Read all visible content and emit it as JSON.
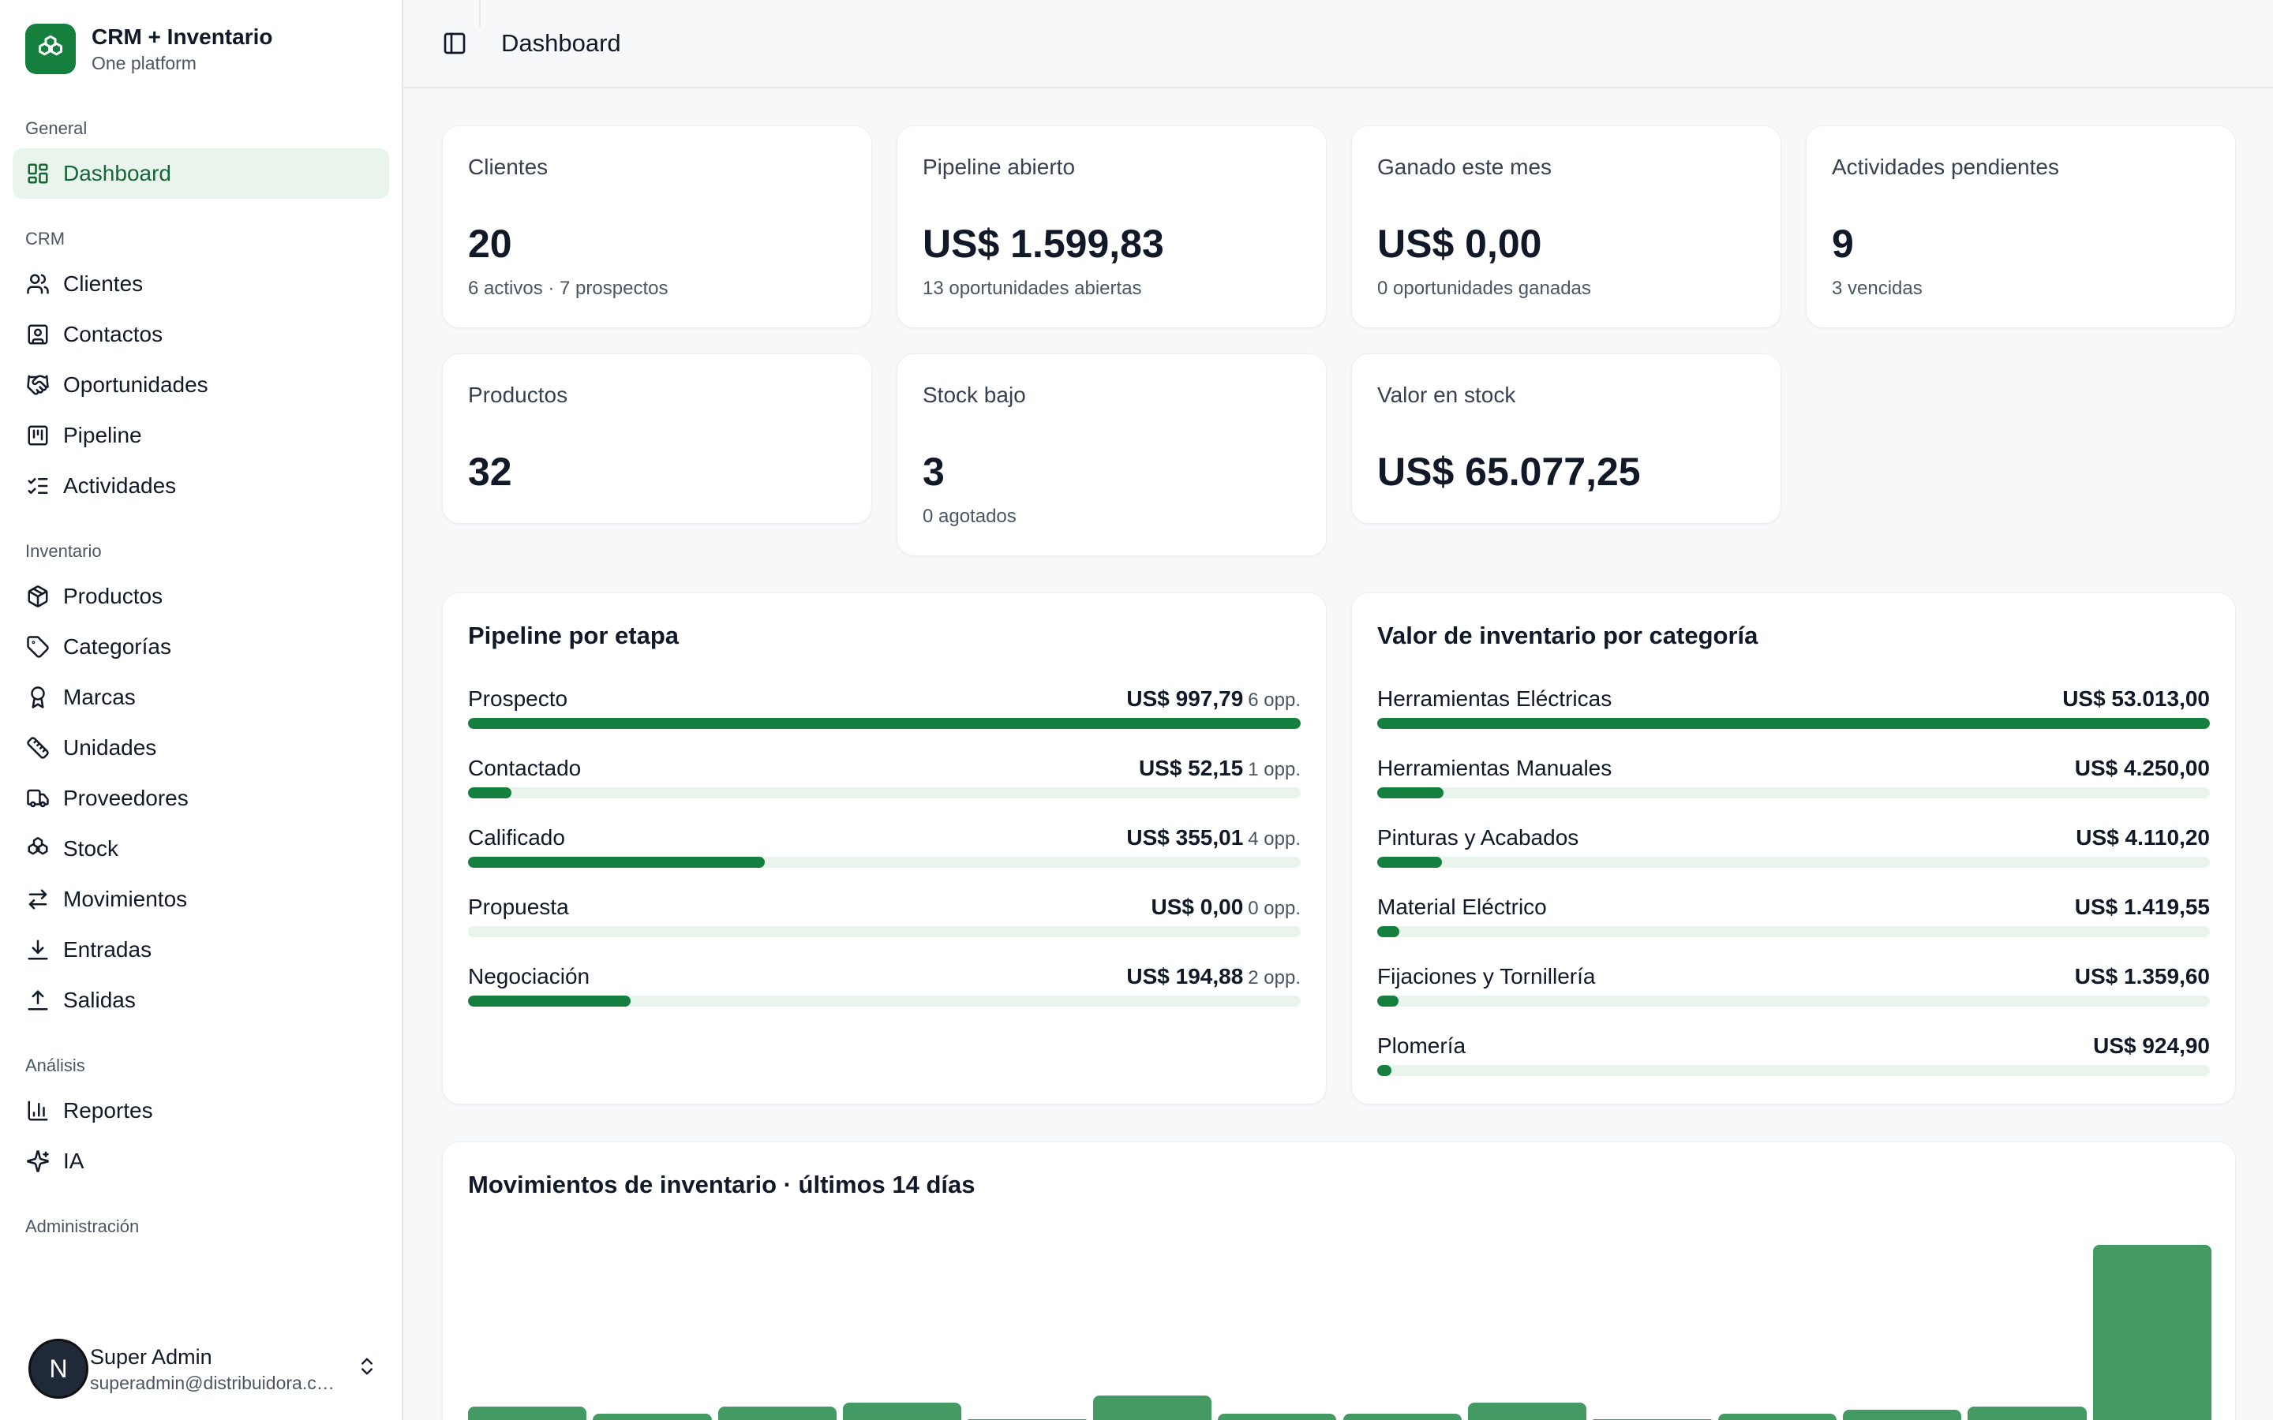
{
  "brand": {
    "title": "CRM + Inventario",
    "subtitle": "One platform"
  },
  "sidebar": {
    "groups": [
      {
        "label": "General",
        "items": [
          {
            "label": "Dashboard",
            "icon": "dashboard-icon",
            "active": true
          }
        ]
      },
      {
        "label": "CRM",
        "items": [
          {
            "label": "Clientes",
            "icon": "users-icon"
          },
          {
            "label": "Contactos",
            "icon": "contact-icon"
          },
          {
            "label": "Oportunidades",
            "icon": "handshake-icon"
          },
          {
            "label": "Pipeline",
            "icon": "kanban-icon"
          },
          {
            "label": "Actividades",
            "icon": "checklist-icon"
          }
        ]
      },
      {
        "label": "Inventario",
        "items": [
          {
            "label": "Productos",
            "icon": "package-icon"
          },
          {
            "label": "Categorías",
            "icon": "tag-icon"
          },
          {
            "label": "Marcas",
            "icon": "award-icon"
          },
          {
            "label": "Unidades",
            "icon": "ruler-icon"
          },
          {
            "label": "Proveedores",
            "icon": "truck-icon"
          },
          {
            "label": "Stock",
            "icon": "boxes-icon"
          },
          {
            "label": "Movimientos",
            "icon": "arrows-icon"
          },
          {
            "label": "Entradas",
            "icon": "download-icon"
          },
          {
            "label": "Salidas",
            "icon": "upload-icon"
          }
        ]
      },
      {
        "label": "Análisis",
        "items": [
          {
            "label": "Reportes",
            "icon": "bar-chart-icon"
          },
          {
            "label": "IA",
            "icon": "sparkles-icon"
          }
        ]
      },
      {
        "label": "Administración",
        "items": []
      }
    ],
    "user": {
      "initial": "N",
      "name": "Super Admin",
      "email": "superadmin@distribuidora.com"
    }
  },
  "header": {
    "title": "Dashboard"
  },
  "stats": [
    {
      "label": "Clientes",
      "value": "20",
      "sub": "6 activos · 7 prospectos"
    },
    {
      "label": "Pipeline abierto",
      "value": "US$ 1.599,83",
      "sub": "13 oportunidades abiertas"
    },
    {
      "label": "Ganado este mes",
      "value": "US$ 0,00",
      "sub": "0 oportunidades ganadas"
    },
    {
      "label": "Actividades pendientes",
      "value": "9",
      "sub": "3 vencidas"
    },
    {
      "label": "Productos",
      "value": "32",
      "sub": ""
    },
    {
      "label": "Stock bajo",
      "value": "3",
      "sub": "0 agotados"
    },
    {
      "label": "Valor en stock",
      "value": "US$ 65.077,25",
      "sub": ""
    }
  ],
  "pipeline": {
    "title": "Pipeline por etapa",
    "rows": [
      {
        "label": "Prospecto",
        "amount": "US$ 997,79",
        "opp": "6 opp.",
        "fraction": 1.0
      },
      {
        "label": "Contactado",
        "amount": "US$ 52,15",
        "opp": "1 opp.",
        "fraction": 0.052
      },
      {
        "label": "Calificado",
        "amount": "US$ 355,01",
        "opp": "4 opp.",
        "fraction": 0.356
      },
      {
        "label": "Propuesta",
        "amount": "US$ 0,00",
        "opp": "0 opp.",
        "fraction": 0
      },
      {
        "label": "Negociación",
        "amount": "US$ 194,88",
        "opp": "2 opp.",
        "fraction": 0.195
      }
    ]
  },
  "inventory": {
    "title": "Valor de inventario por categoría",
    "rows": [
      {
        "label": "Herramientas Eléctricas",
        "amount": "US$ 53.013,00",
        "fraction": 1.0
      },
      {
        "label": "Herramientas Manuales",
        "amount": "US$ 4.250,00",
        "fraction": 0.08
      },
      {
        "label": "Pinturas y Acabados",
        "amount": "US$ 4.110,20",
        "fraction": 0.078
      },
      {
        "label": "Material Eléctrico",
        "amount": "US$ 1.419,55",
        "fraction": 0.027
      },
      {
        "label": "Fijaciones y Tornillería",
        "amount": "US$ 1.359,60",
        "fraction": 0.026
      },
      {
        "label": "Plomería",
        "amount": "US$ 924,90",
        "fraction": 0.017
      }
    ]
  },
  "movements": {
    "title": "Movimientos de inventario · últimos 14 días",
    "values": [
      4,
      2,
      4,
      5,
      0.5,
      7,
      2,
      2,
      5,
      0.5,
      2,
      3,
      4,
      49
    ]
  },
  "colors": {
    "accent": "#15803d",
    "accent_light": "#e9f5ec",
    "bar_movements": "#449a63"
  }
}
